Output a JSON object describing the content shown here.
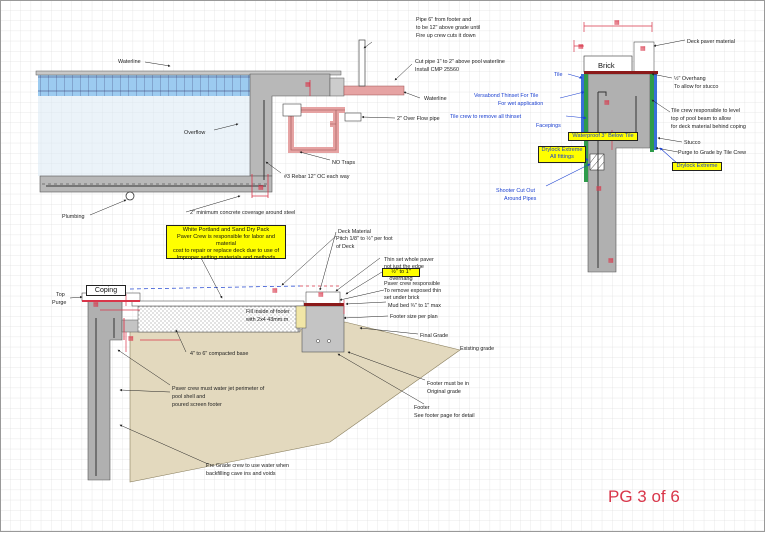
{
  "page": {
    "page_label": "PG 3 of 6"
  },
  "pool": {
    "waterline_top": "Waterline",
    "waterline_right": "Waterline",
    "pipe_note": [
      "Pipe 6\" from footer and",
      "to be 12\" above grade until",
      "Fire up crew cuts it down"
    ],
    "cut_pipe_note": [
      "Cut pipe 1\" to 2\" above pool waterline",
      "Install CMP 25560"
    ],
    "overflow": "Overflow",
    "overflow_pipe": "2\" Over Flow pipe",
    "no_traps": "NO Traps",
    "rebar": "#3 Rebar 12\" OC each way",
    "plumbing": "Plumbing",
    "concrete_coverage": "2\" minimum concrete coverage around steel"
  },
  "deck": {
    "pitch": [
      "Pitch 1/8\" to ½\" per foot",
      "of Deck"
    ],
    "deck_material": "Deck Material",
    "thin_set": [
      "Thin set whole paver",
      "not just the edge"
    ],
    "overhang": "½\" to 1\" overhang",
    "paver_crew_thinset": [
      "Paver crew responsible",
      "To remove exposed thin",
      "set under brick"
    ],
    "mud_bed": "Mud bed ¾\" to 1\" max",
    "footer_size": "Footer size per plan",
    "final_grade": "Final Grade",
    "existing_grade": "Existing grade",
    "footer_original": [
      "Footer must be in",
      "Original grade"
    ],
    "footer_detail": [
      "Footer",
      "See footer page for detail"
    ],
    "footer_inside": [
      "Fill inside of footer",
      "with 2x4 43mm.m"
    ],
    "compacted_base": "4\" to 6\" compacted base",
    "water_jet": [
      "Paver crew must water jet perimeter of",
      "pool shell and",
      "poured screen footer"
    ],
    "pre_grade": [
      "Pre Grade crew to use water when",
      "backfilling cave ins and voids"
    ],
    "top_purge": [
      "Top",
      "Purge"
    ],
    "coping": "Coping",
    "yellow_note": [
      "White Portland and Sand Dry Pack",
      "Paver Crew is responsible for labor and material",
      "cost to repair or replace deck due to use of",
      "Improper setting materials and methods"
    ]
  },
  "detail": {
    "deck_paver": "Deck paver material",
    "brick": "Brick",
    "overhang": [
      "½\" Overhang",
      "To allow for stucco"
    ],
    "tile": "Tile",
    "versabond": [
      "Versabond Thinset For Tile",
      "For wet application"
    ],
    "tile_crew_thinset": [
      "Tile crew to remove all thinset",
      "Facepings"
    ],
    "waterproof": "Waterproof 3\" Below Tile",
    "drylock_fittings": [
      "Drylock Extreme",
      "All fittings"
    ],
    "shooter": [
      "Shooter Cut Out",
      "Around Pipes"
    ],
    "tile_crew_level": [
      "Tile crew responsible to level",
      "top of pool beam to allow",
      "for deck material behind coping"
    ],
    "stucco": "Stucco",
    "purge": "Purge to Grade by Tile Crew",
    "drylock_extreme": "Drylock Extreme"
  },
  "colors": {
    "grid": "#d4d4d4",
    "concrete": "#b0b0b0",
    "soil": "#e3d9be",
    "water": "#a9d4f0",
    "blue_label": "#1a3fd0",
    "red": "#d9364a",
    "yellow": "#ffff00"
  }
}
